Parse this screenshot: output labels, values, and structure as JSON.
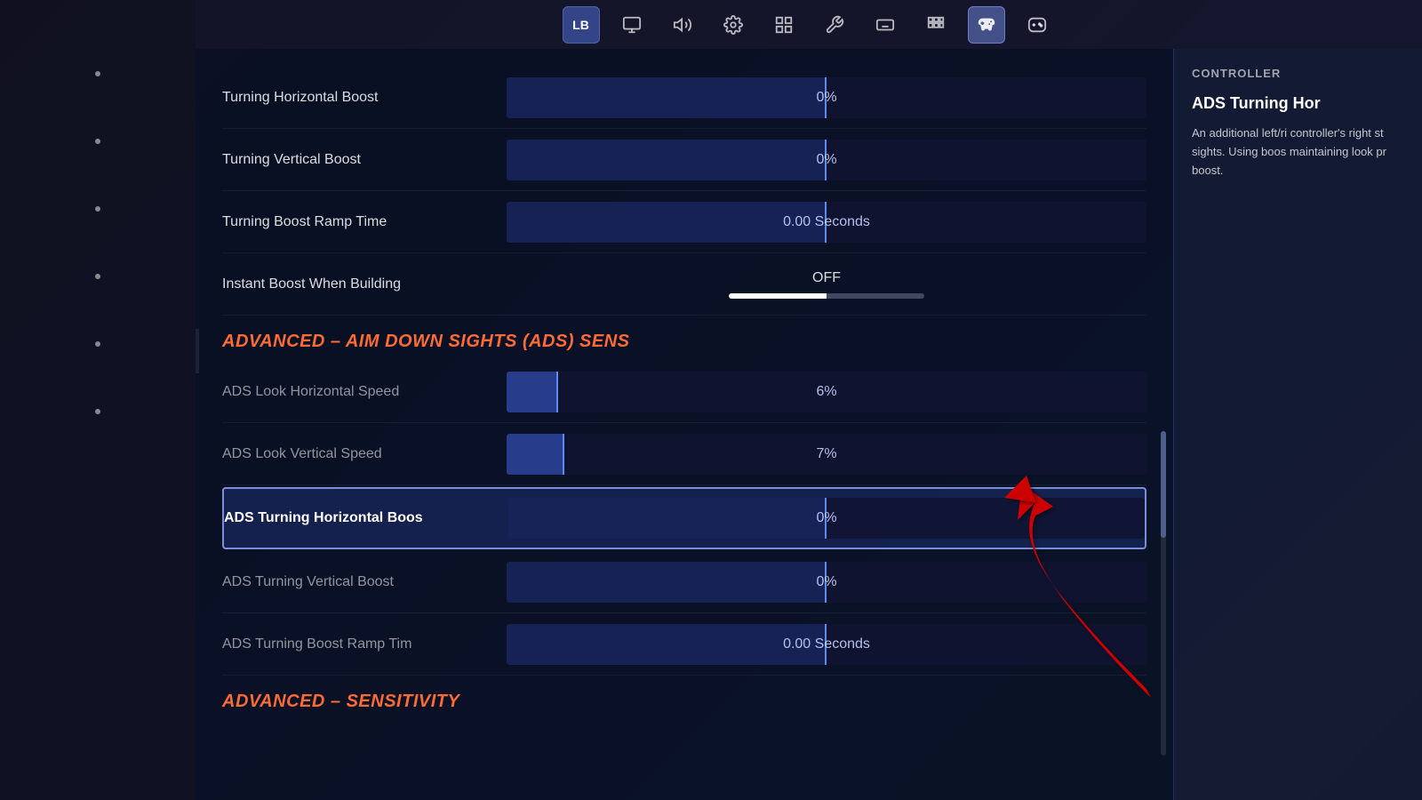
{
  "topNav": {
    "icons": [
      {
        "name": "lb-badge",
        "label": "LB",
        "active": false,
        "isLB": true
      },
      {
        "name": "monitor-icon",
        "label": "🖥",
        "active": false
      },
      {
        "name": "volume-icon",
        "label": "🔊",
        "active": false
      },
      {
        "name": "settings-icon",
        "label": "⚙",
        "active": false
      },
      {
        "name": "layout-icon",
        "label": "▦",
        "active": false
      },
      {
        "name": "wrench-icon",
        "label": "🔧",
        "active": false
      },
      {
        "name": "keyboard-icon",
        "label": "⌨",
        "active": false
      },
      {
        "name": "grid-icon",
        "label": "⊞",
        "active": false
      },
      {
        "name": "controller-main-icon",
        "label": "🎮",
        "active": true
      },
      {
        "name": "gamepad-icon",
        "label": "🕹",
        "active": false
      }
    ]
  },
  "rightPanel": {
    "title": "CONTROLLER",
    "subtitle": "ADS Turning Hor",
    "description": "An additional left/ri controller's right st sights.  Using boos maintaining look pr boost."
  },
  "settings": {
    "turningHorizontalBoost": {
      "label": "Turning Horizontal Boost",
      "value": "0%",
      "sliderType": "zero"
    },
    "turningVerticalBoost": {
      "label": "Turning Vertical Boost",
      "value": "0%",
      "sliderType": "zero"
    },
    "turningBoostRampTime": {
      "label": "Turning Boost Ramp Time",
      "value": "0.00 Seconds",
      "sliderType": "zero"
    },
    "instantBoostBuilding": {
      "label": "Instant Boost When Building",
      "value": "OFF"
    },
    "adsSection": {
      "header": "ADVANCED – AIM DOWN SIGHTS (ADS) SENS"
    },
    "adsLookHorizontal": {
      "label": "ADS Look Horizontal Speed",
      "value": "6%",
      "sliderType": "small"
    },
    "adsLookVertical": {
      "label": "ADS Look Vertical Speed",
      "value": "7%",
      "sliderType": "medium"
    },
    "adsTurningHorizontalBoost": {
      "label": "ADS Turning Horizontal Boos",
      "value": "0%",
      "sliderType": "zero",
      "highlighted": true
    },
    "adsTurningVerticalBoost": {
      "label": "ADS Turning Vertical Boost",
      "value": "0%",
      "sliderType": "zero"
    },
    "adsTurningBoostRampTime": {
      "label": "ADS Turning Boost Ramp Tim",
      "value": "0.00 Seconds",
      "sliderType": "zero"
    },
    "sensitivitySection": {
      "header": "ADVANCED – SENSITIVITY"
    }
  }
}
